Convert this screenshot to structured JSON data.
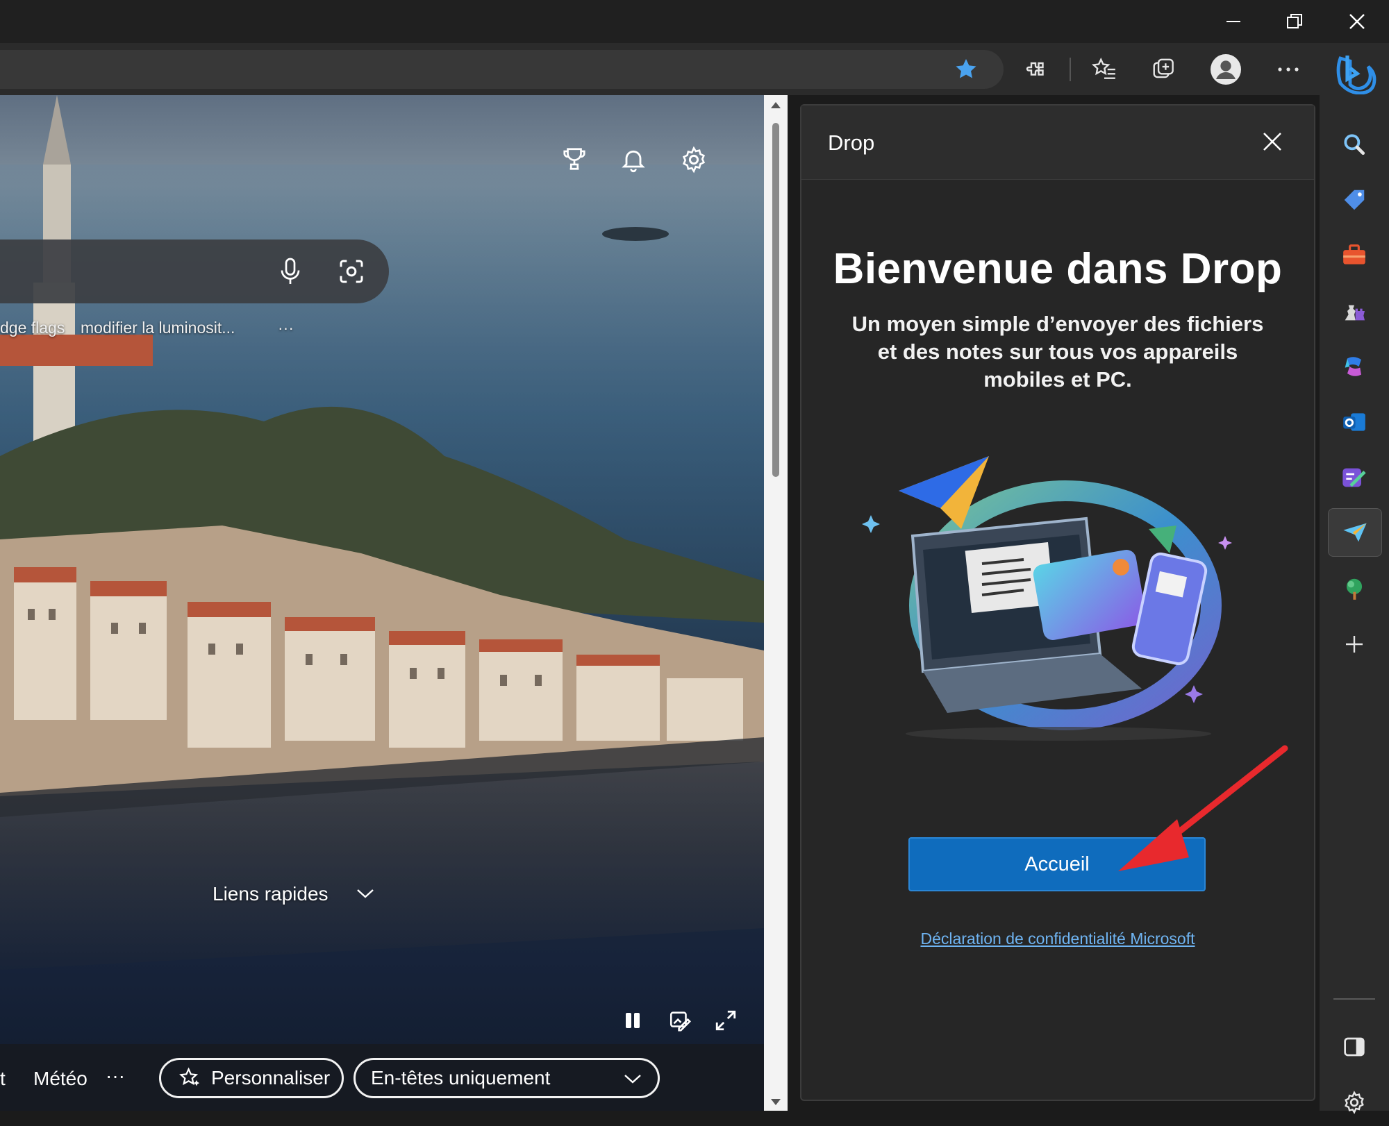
{
  "browser": {
    "window_controls": {
      "minimize": "minimize-icon",
      "restore": "restore-icon",
      "close": "close-icon"
    },
    "toolbar_icons": [
      "favorite-star-icon",
      "extensions-icon",
      "favorites-icon",
      "collections-icon",
      "profile-icon",
      "more-icon",
      "bing-icon"
    ],
    "accent_color": "#1a7fe0"
  },
  "newtab": {
    "top_icons": [
      "rewards-trophy-icon",
      "notifications-bell-icon",
      "settings-gear-icon"
    ],
    "search": {
      "icons": [
        "microphone-icon",
        "visual-search-icon"
      ]
    },
    "quick_searches": [
      "dge flags",
      "modifier la luminosit...",
      "···"
    ],
    "quick_links_label": "Liens rapides",
    "media_controls": [
      "pause-icon",
      "image-edit-icon",
      "expand-icon"
    ],
    "bottom_nav": {
      "partial_item": "t",
      "meteo_label": "Météo",
      "more_label": "···",
      "personalize_label": "Personnaliser",
      "layout_select_value": "En-têtes uniquement"
    }
  },
  "drop_pane": {
    "header_title": "Drop",
    "welcome_title": "Bienvenue dans Drop",
    "welcome_subtitle": "Un moyen simple d’envoyer des fichiers et des notes sur tous vos appareils mobiles et PC.",
    "primary_button_label": "Accueil",
    "privacy_link": "Déclaration de confidentialité Microsoft",
    "annotation_arrow_color": "#e8292d"
  },
  "sidebar": {
    "items": [
      "search-icon",
      "shopping-tag-icon",
      "tools-briefcase-icon",
      "games-icon",
      "copilot-icon",
      "outlook-icon",
      "designer-icon",
      "drop-icon",
      "tree-icon",
      "add-icon"
    ],
    "active_item": "drop-icon",
    "bottom_items": [
      "hide-sidebar-icon",
      "sidebar-settings-icon"
    ]
  }
}
